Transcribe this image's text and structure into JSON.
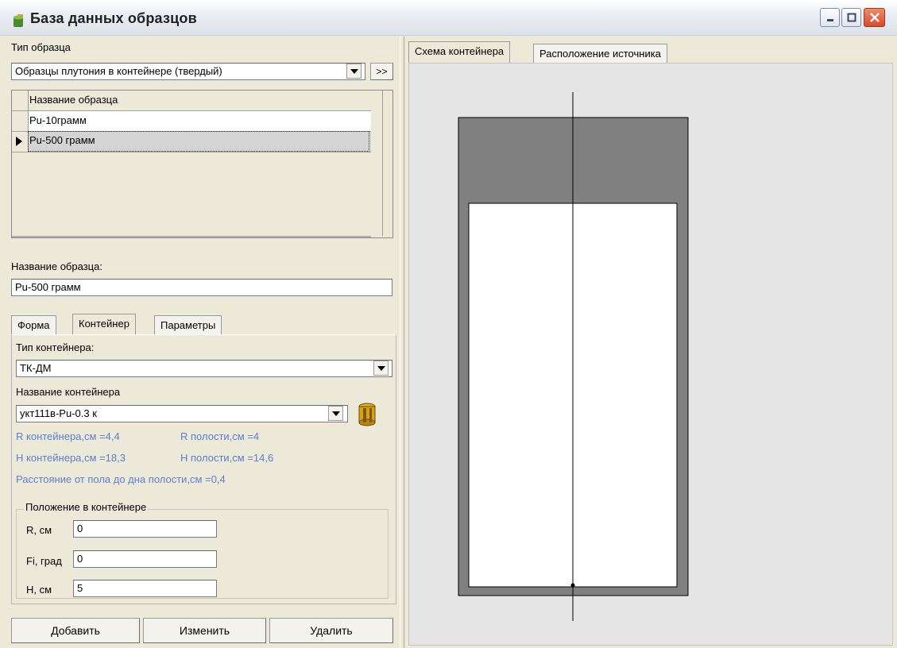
{
  "window": {
    "title": "База данных образцов"
  },
  "sample_type": {
    "label": "Тип образца",
    "value": "Образцы плутония в контейнере (твердый)",
    "more_button": ">>"
  },
  "sample_grid": {
    "header": "Название образца",
    "rows": [
      {
        "name": "Pu-10грамм",
        "selected": false
      },
      {
        "name": "Pu-500 грамм",
        "selected": true
      }
    ]
  },
  "sample_name": {
    "label": "Название образца:",
    "value": "Pu-500 грамм"
  },
  "tabs": [
    {
      "label": "Форма"
    },
    {
      "label": "Контейнер",
      "active": true
    },
    {
      "label": "Параметры"
    }
  ],
  "container": {
    "type_label": "Тип контейнера:",
    "type_value": "ТК-ДМ",
    "name_label": "Название контейнера",
    "name_value": "укт111в-Pu-0.3 к",
    "info": {
      "r_container": "R контейнера,см =4,4",
      "r_cavity": "R полости,см =4",
      "h_container": "H контейнера,см =18,3",
      "h_cavity": "H полости,см =14,6",
      "floor_distance": "Расстояние от пола до дна полости,см =0,4"
    }
  },
  "position": {
    "legend": "Положение в контейнере",
    "r_label": "R, см",
    "r_value": "0",
    "fi_label": "Fi, град",
    "fi_value": "0",
    "h_label": "H, см",
    "h_value": "5"
  },
  "buttons": {
    "add": "Добавить",
    "edit": "Изменить",
    "delete": "Удалить"
  },
  "right_tabs": [
    {
      "label": "Схема контейнера",
      "active": true
    },
    {
      "label": "Расположение источника"
    }
  ],
  "colors": {
    "container_wall": "#808080",
    "cavity": "#ffffff",
    "info_text": "#5c7fcf"
  }
}
